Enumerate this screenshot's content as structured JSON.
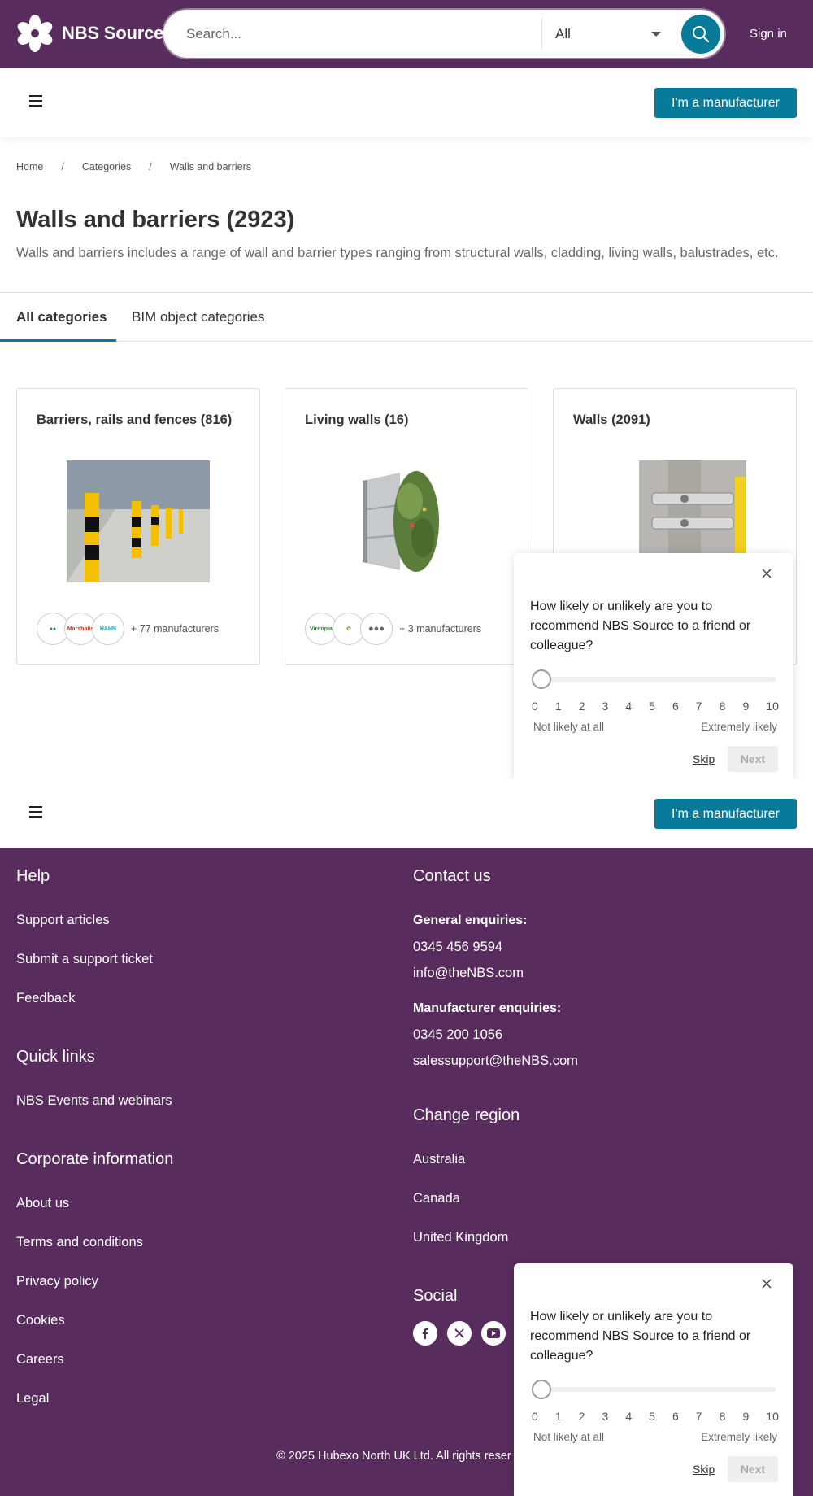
{
  "header": {
    "brand": "NBS Source",
    "search_placeholder": "Search...",
    "search_scope": "All",
    "sign_in": "Sign in"
  },
  "subbar": {
    "manufacturer_button": "I'm a manufacturer"
  },
  "breadcrumb": [
    "Home",
    "Categories",
    "Walls and barriers"
  ],
  "page": {
    "title": "Walls and barriers (2923)",
    "description": "Walls and barriers includes a range of wall and barrier types ranging from structural walls, cladding, living walls, balustrades, etc."
  },
  "tabs": [
    {
      "label": "All categories",
      "active": true
    },
    {
      "label": "BIM object categories",
      "active": false
    }
  ],
  "cards": [
    {
      "title": "Barriers, rails and fences (816)",
      "manufacturers": "+ 77 manufacturers",
      "logos": [
        "Marshalls",
        "HAHN"
      ]
    },
    {
      "title": "Living walls (16)",
      "manufacturers": "+ 3 manufacturers",
      "logos": [
        "Viritopia"
      ]
    },
    {
      "title": "Walls (2091)",
      "manufacturers": "",
      "logos": []
    }
  ],
  "survey": {
    "question": "How likely or unlikely are you to recommend NBS Source to a friend or colleague?",
    "scale": [
      "0",
      "1",
      "2",
      "3",
      "4",
      "5",
      "6",
      "7",
      "8",
      "9",
      "10"
    ],
    "low_label": "Not likely at all",
    "high_label": "Extremely likely",
    "skip": "Skip",
    "next": "Next"
  },
  "footer": {
    "help": {
      "heading": "Help",
      "links": [
        "Support articles",
        "Submit a support ticket",
        "Feedback"
      ]
    },
    "quick_links": {
      "heading": "Quick links",
      "links": [
        "NBS Events and webinars"
      ]
    },
    "corporate": {
      "heading": "Corporate information",
      "links": [
        "About us",
        "Terms and conditions",
        "Privacy policy",
        "Cookies",
        "Careers",
        "Legal"
      ]
    },
    "contact": {
      "heading": "Contact us",
      "general_label": "General enquiries:",
      "general_phone": "0345 456 9594",
      "general_email": "info@theNBS.com",
      "manufacturer_label": "Manufacturer enquiries:",
      "manufacturer_phone": "0345 200 1056",
      "manufacturer_email": "salessupport@theNBS.com"
    },
    "region": {
      "heading": "Change region",
      "links": [
        "Australia",
        "Canada",
        "United Kingdom"
      ]
    },
    "social": {
      "heading": "Social",
      "icons": [
        "facebook-icon",
        "x-icon",
        "youtube-icon"
      ]
    },
    "copyright": "© 2025 Hubexo North UK Ltd. All rights reser"
  },
  "colors": {
    "brand_purple": "#592c5e",
    "accent_teal": "#087a9a"
  }
}
